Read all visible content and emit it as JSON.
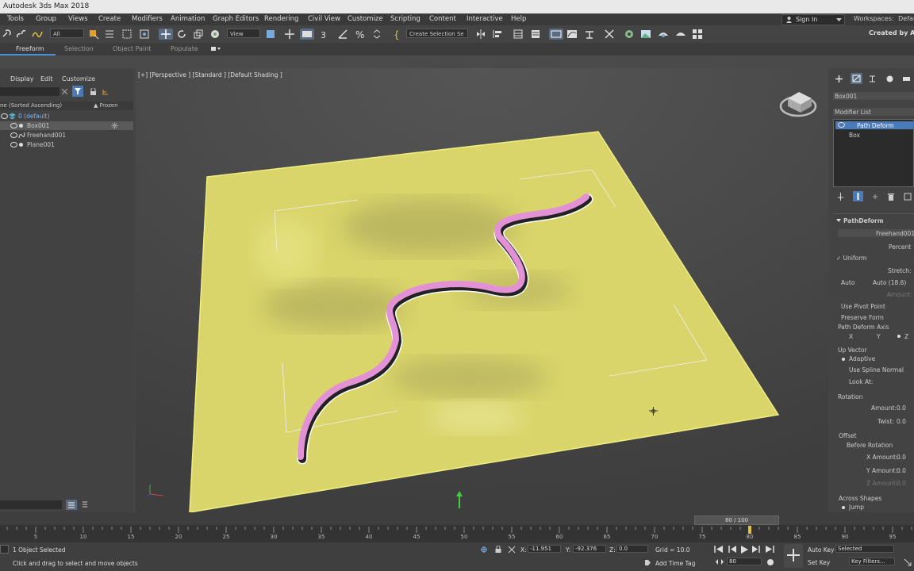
{
  "window": {
    "title": "Autodesk 3ds Max 2018"
  },
  "menu": {
    "items": [
      "Tools",
      "Group",
      "Views",
      "Create",
      "Modifiers",
      "Animation",
      "Graph Editors",
      "Rendering",
      "Civil View",
      "Customize",
      "Scripting",
      "Content",
      "Interactive",
      "Help"
    ],
    "sign_in": "Sign In",
    "workspaces_label": "Workspaces:",
    "workspaces_value": "Default"
  },
  "toolbar": {
    "selection_filter": "All",
    "reference_coord": "View",
    "named_selection": "Create Selection Se",
    "created_by": "Created by Aut"
  },
  "ribbon": {
    "tabs": [
      "Freeform",
      "Selection",
      "Object Paint",
      "Populate"
    ]
  },
  "scene_explorer": {
    "menus": [
      "Display",
      "Edit",
      "Customize"
    ],
    "header_name": "ne (Sorted Ascending)",
    "header_frozen": "▲ Frozen",
    "rows": [
      "0 (default)",
      "Box001",
      "Freehand001",
      "Plane001"
    ]
  },
  "viewport": {
    "label": "[+] [Perspective ] [Standard ] [Default Shading ]"
  },
  "command_panel": {
    "object_name": "Box001",
    "modifier_list": "Modifier List",
    "stack": [
      "Path Deform",
      "Box"
    ],
    "rollout_title": "PathDeform",
    "path_object": "Freehand001",
    "percent_label": "Percent",
    "uniform_label": "Uniform",
    "stretch_label": "Stretch:",
    "auto_label": "Auto",
    "auto_value": "Auto (18.6)",
    "amount_label": "Amount:",
    "use_pivot": "Use Pivot Point",
    "preserve_form": "Preserve Form",
    "axis_label": "Path Deform Axis",
    "axis_x": "X",
    "axis_y": "Y",
    "axis_z": "Z",
    "up_vector": "Up Vector",
    "adaptive": "Adaptive",
    "use_spline_normal": "Use Spline Normal",
    "look_at": "Look At:",
    "rotation": "Rotation",
    "rot_amount_label": "Amount:",
    "rot_amount_value": "0.0",
    "twist_label": "Twist:",
    "twist_value": "0.0",
    "offset": "Offset",
    "before_rotation": "Before Rotation",
    "x_amount_label": "X Amount:",
    "x_amount_value": "0.0",
    "y_amount_label": "Y Amount:",
    "y_amount_value": "0.0",
    "z_amount_label": "Z Amount:",
    "z_amount_value": "0.0",
    "across_shapes": "Across Shapes",
    "jump": "Jump"
  },
  "timeline": {
    "current": "80 / 100",
    "ticks": [
      "5",
      "10",
      "15",
      "20",
      "25",
      "30",
      "35",
      "40",
      "45",
      "50",
      "55",
      "60",
      "65",
      "70",
      "75",
      "80",
      "85",
      "90",
      "95"
    ],
    "current_frame": 80
  },
  "status": {
    "selected": "1 Object Selected",
    "prompt": "Click and drag to select and move objects",
    "x_label": "X:",
    "x_value": "-11.951",
    "y_label": "Y:",
    "y_value": "-92.376",
    "z_label": "Z:",
    "z_value": "0.0",
    "grid": "Grid = 10.0",
    "add_time_tag": "Add Time Tag",
    "frame_value": "80",
    "auto_key": "Auto Key",
    "set_key": "Set Key",
    "selected_combo": "Selected",
    "key_filters": "Key Filters..."
  },
  "colors": {
    "ground": "#d9d56a",
    "tube": "#e291d5",
    "accent": "#4a90d9"
  }
}
